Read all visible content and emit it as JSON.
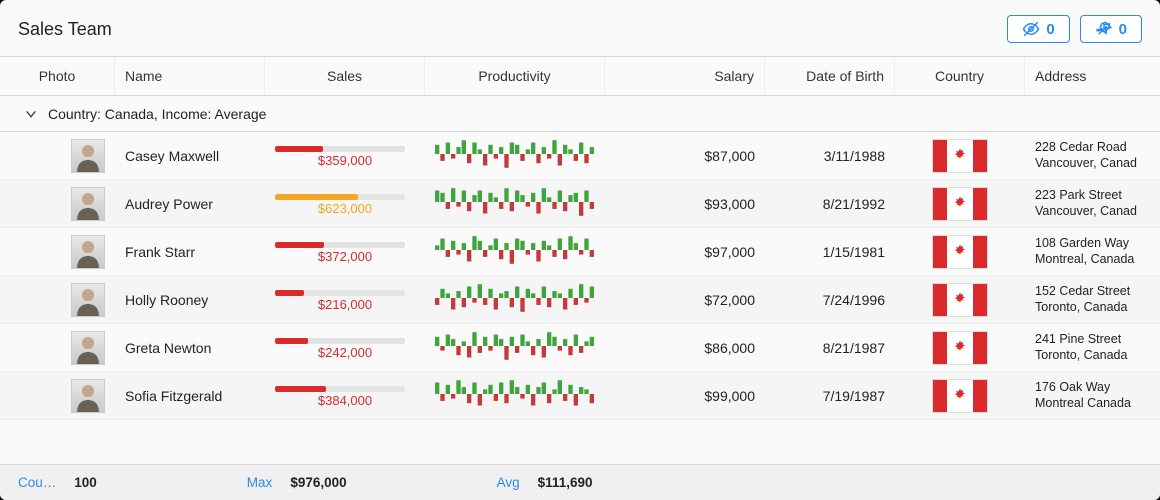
{
  "title": "Sales Team",
  "hidden_count": 0,
  "pinned_count": 0,
  "columns": {
    "photo": "Photo",
    "name": "Name",
    "sales": "Sales",
    "productivity": "Productivity",
    "salary": "Salary",
    "dob": "Date of Birth",
    "country": "Country",
    "address": "Address"
  },
  "group_label": "Country: Canada, Income: Average",
  "rows": [
    {
      "name": "Casey Maxwell",
      "sales": "$359,000",
      "sales_pct": 37,
      "sales_color": "red",
      "salary": "$87,000",
      "dob": "3/11/1988",
      "address1": "228 Cedar Road",
      "address2": "Vancouver, Canad",
      "spark": [
        4,
        -3,
        5,
        -2,
        3,
        6,
        -4,
        5,
        2,
        -5,
        4,
        -2,
        3,
        -6,
        5,
        4,
        -3,
        2,
        5,
        -4,
        3,
        -2,
        6,
        -5,
        4,
        2,
        -3,
        5,
        -4,
        3
      ]
    },
    {
      "name": "Audrey Power",
      "sales": "$623,000",
      "sales_pct": 64,
      "sales_color": "orange",
      "salary": "$93,000",
      "dob": "8/21/1992",
      "address1": "223 Park Street",
      "address2": "Vancouver, Canad",
      "spark": [
        5,
        4,
        -3,
        6,
        -2,
        5,
        -4,
        3,
        5,
        -5,
        4,
        2,
        -3,
        6,
        -4,
        5,
        3,
        -2,
        4,
        -5,
        6,
        2,
        -3,
        5,
        -4,
        3,
        4,
        -6,
        5,
        -3
      ]
    },
    {
      "name": "Frank Starr",
      "sales": "$372,000",
      "sales_pct": 38,
      "sales_color": "red",
      "salary": "$97,000",
      "dob": "1/15/1981",
      "address1": "108 Garden Way",
      "address2": "Montreal, Canada",
      "spark": [
        2,
        5,
        -3,
        4,
        -2,
        3,
        -5,
        6,
        4,
        -3,
        2,
        5,
        -4,
        3,
        -6,
        5,
        4,
        -2,
        3,
        -5,
        4,
        2,
        -3,
        5,
        -4,
        6,
        3,
        -2,
        5,
        -3
      ]
    },
    {
      "name": "Holly Rooney",
      "sales": "$216,000",
      "sales_pct": 22,
      "sales_color": "red",
      "salary": "$72,000",
      "dob": "7/24/1996",
      "address1": "152 Cedar Street",
      "address2": "Toronto, Canada",
      "spark": [
        -3,
        4,
        2,
        -5,
        3,
        -4,
        5,
        -2,
        6,
        -3,
        4,
        -5,
        2,
        3,
        -4,
        5,
        -6,
        4,
        2,
        -3,
        5,
        -4,
        3,
        2,
        -5,
        4,
        -3,
        6,
        -2,
        5
      ]
    },
    {
      "name": "Greta Newton",
      "sales": "$242,000",
      "sales_pct": 25,
      "sales_color": "red",
      "salary": "$86,000",
      "dob": "8/21/1987",
      "address1": "241 Pine Street",
      "address2": "Toronto, Canada",
      "spark": [
        4,
        -2,
        5,
        3,
        -4,
        2,
        -5,
        6,
        -3,
        4,
        -2,
        5,
        3,
        -6,
        4,
        -3,
        5,
        2,
        -4,
        3,
        -5,
        6,
        4,
        -2,
        3,
        -4,
        5,
        -3,
        2,
        4
      ]
    },
    {
      "name": "Sofia Fitzgerald",
      "sales": "$384,000",
      "sales_pct": 39,
      "sales_color": "red",
      "salary": "$99,000",
      "dob": "7/19/1987",
      "address1": "176 Oak Way",
      "address2": "Montreal Canada",
      "spark": [
        5,
        -3,
        4,
        -2,
        6,
        3,
        -4,
        5,
        -5,
        2,
        4,
        -3,
        5,
        -4,
        6,
        3,
        -2,
        4,
        -5,
        3,
        5,
        -4,
        2,
        6,
        -3,
        4,
        -5,
        3,
        2,
        -4
      ]
    }
  ],
  "footer": {
    "count_label": "Cou…",
    "count_value": "100",
    "max_label": "Max",
    "max_value": "$976,000",
    "avg_label": "Avg",
    "avg_value": "$111,690"
  }
}
